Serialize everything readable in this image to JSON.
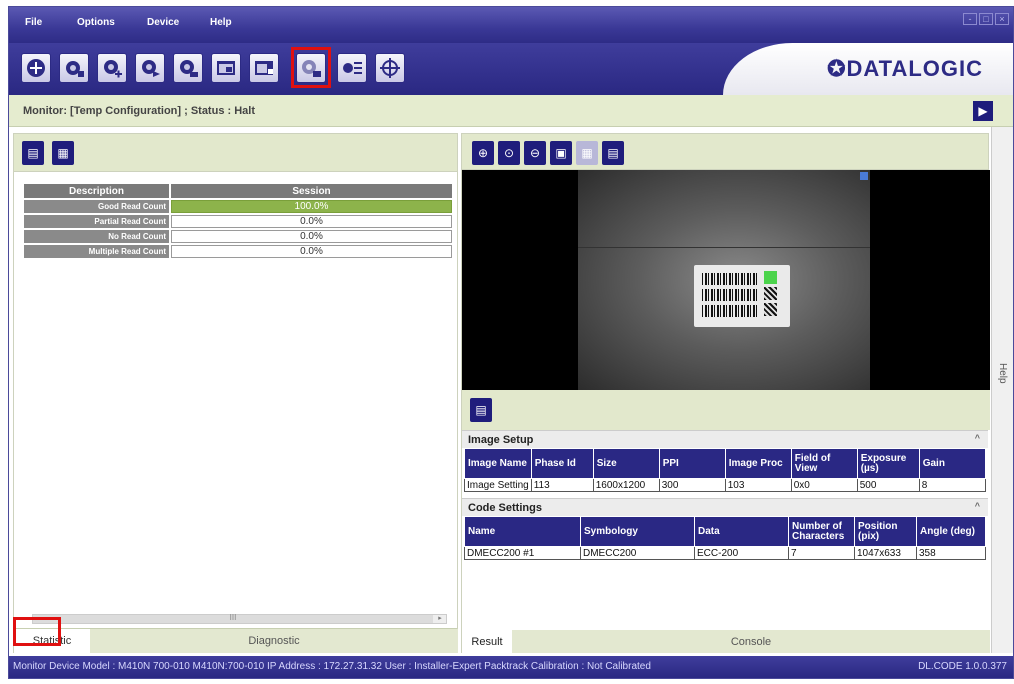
{
  "menu": {
    "file": "File",
    "options": "Options",
    "device": "Device",
    "help": "Help"
  },
  "window_controls": [
    "-",
    "□",
    "×"
  ],
  "toolbar": {
    "buttons": [
      {
        "icon": "crosshair-plus-icon"
      },
      {
        "icon": "camera-settings-icon"
      },
      {
        "icon": "camera-add-icon"
      },
      {
        "icon": "camera-send-icon"
      },
      {
        "icon": "camera-receive-icon"
      },
      {
        "icon": "image-window-icon"
      },
      {
        "icon": "image-window-alt-icon"
      },
      {
        "icon": "monitor-camera-icon"
      },
      {
        "icon": "camera-list-icon"
      },
      {
        "icon": "target-icon"
      }
    ],
    "logo": "DATALOGIC",
    "logo_glyph": "✪"
  },
  "monitor": {
    "title": "Monitor:  [Temp Configuration] ;  Status :  Halt"
  },
  "statistics": {
    "headers": [
      "Description",
      "Session"
    ],
    "rows": [
      {
        "label": "Good Read Count",
        "value": "100.0%"
      },
      {
        "label": "Partial Read Count",
        "value": "0.0%"
      },
      {
        "label": "No Read Count",
        "value": "0.0%"
      },
      {
        "label": "Multiple Read Count",
        "value": "0.0%"
      }
    ],
    "scroll_glyph": "III"
  },
  "left_tabs": {
    "statistic": "Statistic",
    "diagnostic": "Diagnostic"
  },
  "image_setup": {
    "title": "Image Setup",
    "headers": [
      "Image Name",
      "Phase Id",
      "Size",
      "PPI",
      "Image Proc",
      "Field of View",
      "Exposure (µs)",
      "Gain"
    ],
    "row": [
      "Image Setting",
      "113",
      "1600x1200",
      "300",
      "103",
      "0x0",
      "500",
      "8"
    ]
  },
  "code_settings": {
    "title": "Code Settings",
    "headers": [
      "Name",
      "Symbology",
      "Data",
      "Number of Characters",
      "Position (pix)",
      "Angle (deg)"
    ],
    "row": [
      "DMECC200  #1",
      "DMECC200",
      "ECC-200",
      "7",
      "1047x633",
      "358"
    ]
  },
  "right_tabs": {
    "result": "Result",
    "console": "Console"
  },
  "help_label": "Help",
  "status_bar": {
    "text": "Monitor   Device Model : M410N   700-010   M410N:700-010   IP Address :  172.27.31.32   User : Installer-Expert   Packtrack Calibration : Not Calibrated",
    "version": "DL.CODE 1.0.0.377"
  },
  "colors": {
    "brand": "#2d2b85",
    "panel_bg": "#e2e8cc",
    "good": "#8db34b",
    "highlight": "#e01010"
  }
}
